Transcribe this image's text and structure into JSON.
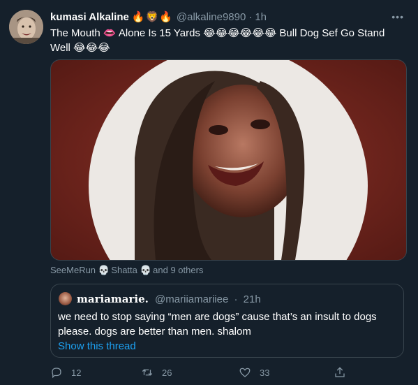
{
  "tweet": {
    "author_name": "kumasi Alkaline",
    "name_emoji": "🔥🦁🔥",
    "handle": "@alkaline9890",
    "separator": "·",
    "time": "1h",
    "more": "•••",
    "text": "The Mouth 👄 Alone Is 15 Yards 😂😂😂😂😂😂 Bull Dog Sef Go Stand Well 😂😂😂",
    "media_icon": "photo-circle"
  },
  "liked_by": {
    "user1": "SeeMeRun",
    "skull_icon": "💀",
    "user2": "Shatta",
    "others": "and 9 others"
  },
  "quote": {
    "author_name": "mariamarie.",
    "handle": "@mariiamariiee",
    "separator": "·",
    "time": "21h",
    "text": "we need to stop saying “men are dogs” cause that’s an insult to dogs please. dogs are better than men. shalom",
    "link": "Show this thread"
  },
  "actions": {
    "reply_count": "12",
    "retweet_count": "26",
    "like_count": "33",
    "icons": [
      "reply-icon",
      "retweet-icon",
      "like-icon",
      "share-icon"
    ]
  },
  "colors": {
    "background": "#15202b",
    "muted": "#8899a6",
    "accent": "#1da1f2",
    "border": "#38444d"
  }
}
